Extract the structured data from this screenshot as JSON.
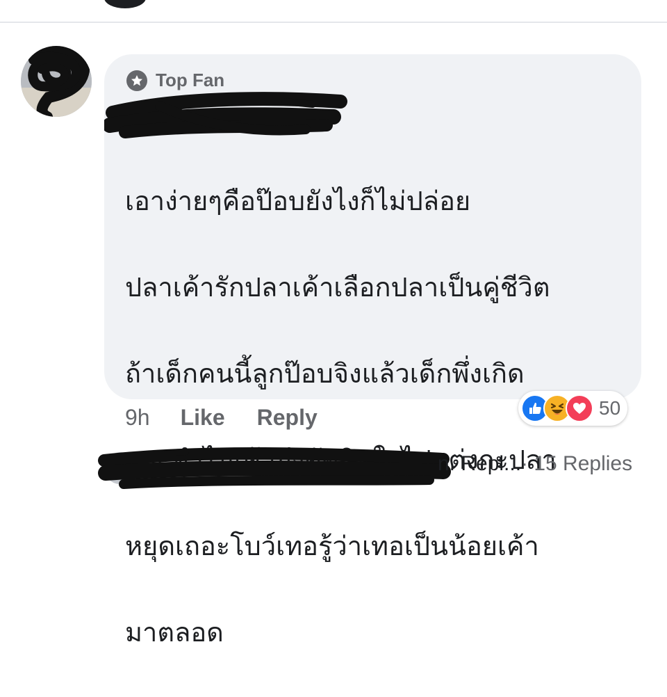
{
  "comment": {
    "badge_label": "Top Fan",
    "badge_icon": "star-icon",
    "text_lines": [
      "เอาง่ายๆคือป๊อบยังไงก็ไม่ปล่อย",
      "ปลาเค้ารักปลาเค้าเลือกปลาเป็นคู่ชีวิต",
      "ถ้าเด็กคนนี้ลูกป๊อบจิงแล้วเด็กพึ่งเกิด",
      "เอง ทำไมเค้าถึงตัดสินใจไปแต่งกะปลา",
      "หยุดเถอะโบว์เทอรู้ว่าเทอเป็นน้อยเค้า",
      "มาตลอด"
    ],
    "time": "9h",
    "like_label": "Like",
    "reply_label": "Reply",
    "reactions": {
      "types": [
        "like",
        "haha",
        "love"
      ],
      "count": "50",
      "colors": {
        "like": "#1877f2",
        "haha": "#f7b125",
        "love": "#f33e58"
      }
    }
  },
  "reply_row": {
    "preview_suffix": "n. Repl...",
    "replies_count": "· 15 Replies"
  }
}
